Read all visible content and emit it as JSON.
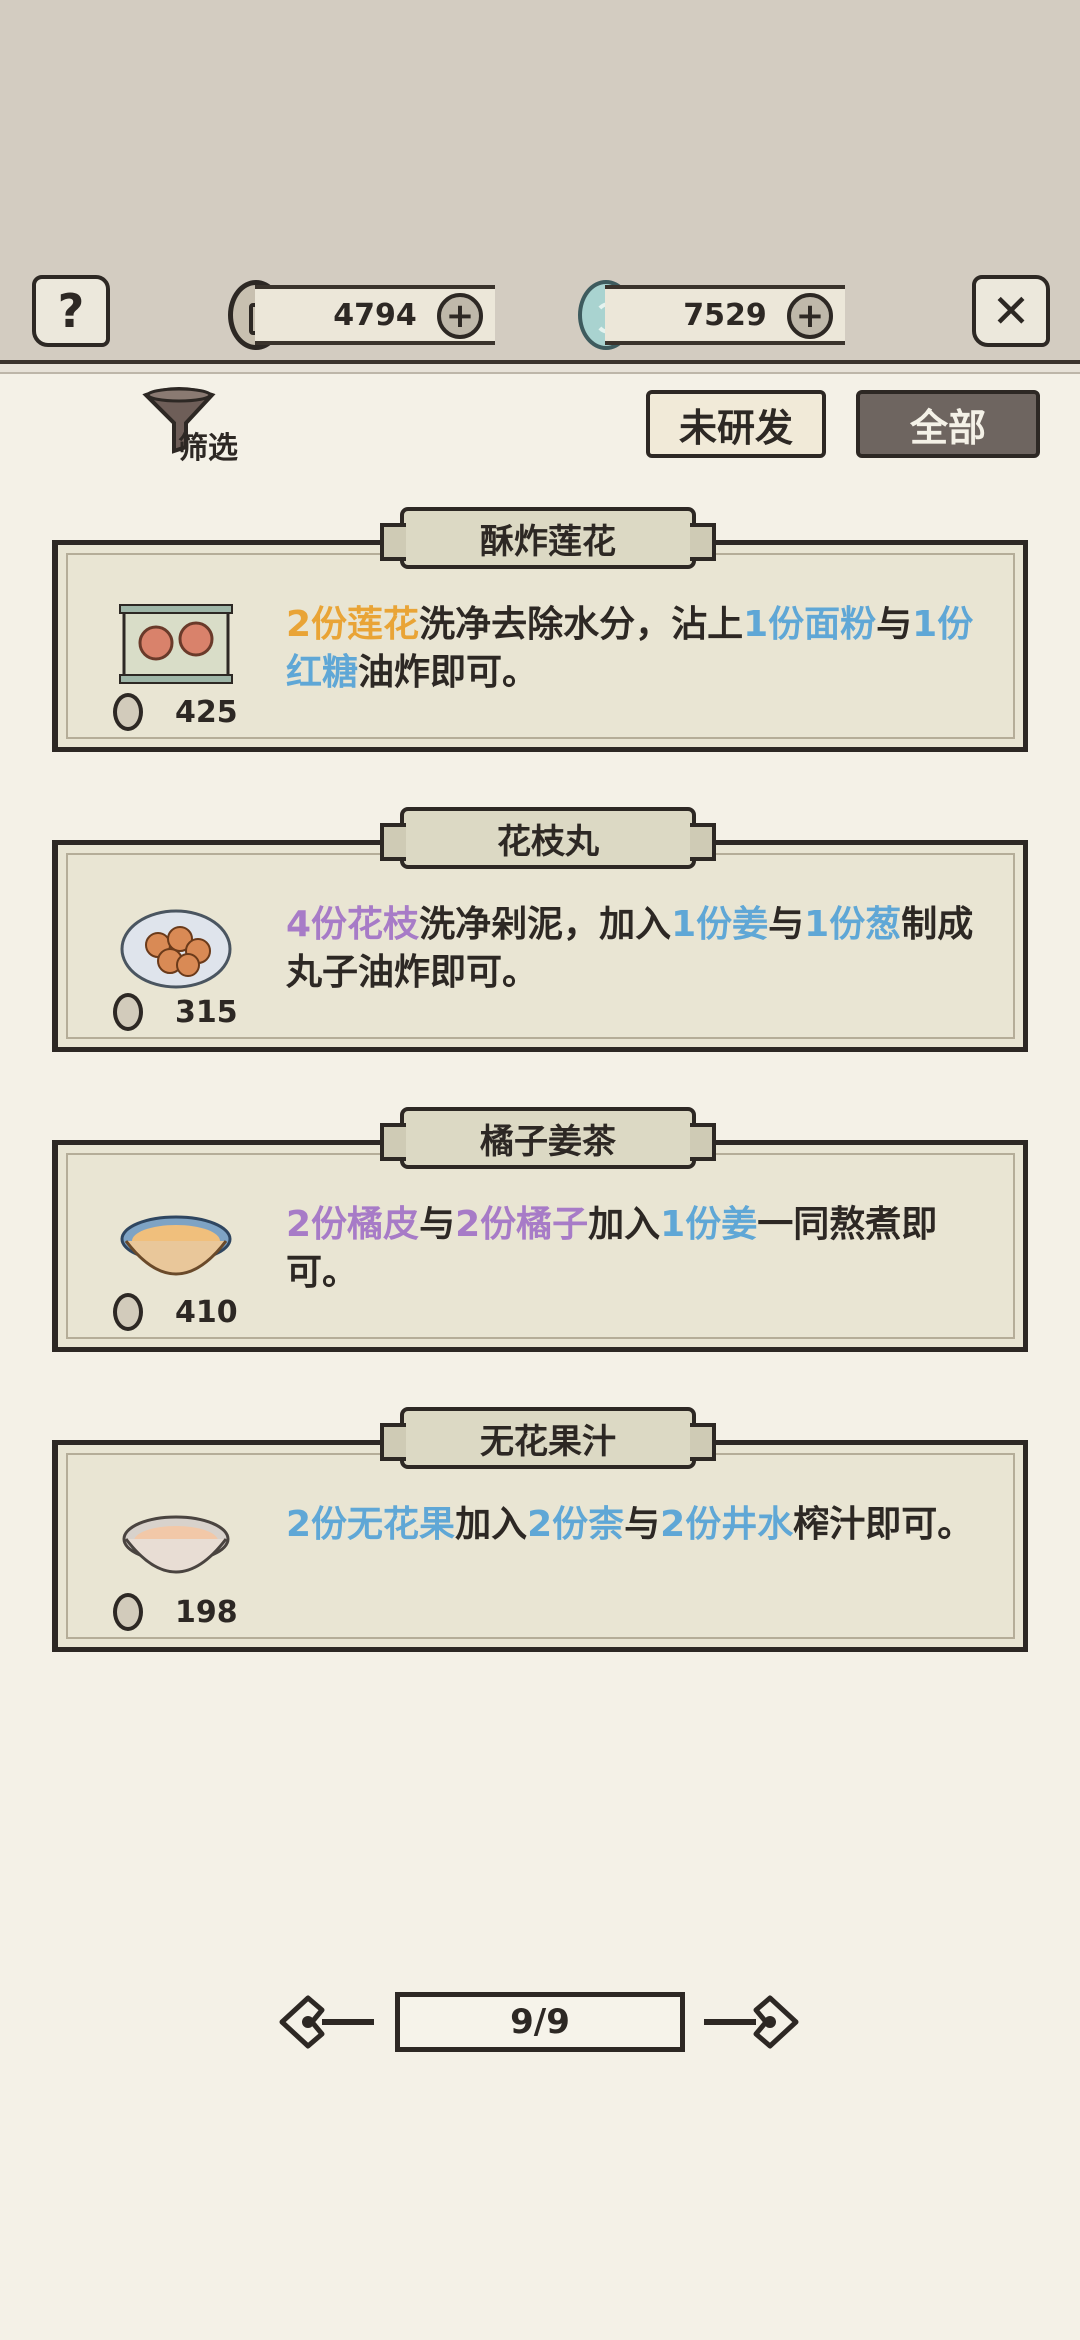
{
  "currency": {
    "coins": "4794",
    "jade": "7529"
  },
  "filter": {
    "label": "筛选"
  },
  "tabs": {
    "unresearched": "未研发",
    "all": "全部"
  },
  "recipes": [
    {
      "title": "酥炸莲花",
      "price": "425",
      "dish_icon": "lotus-scroll-icon",
      "segments": [
        {
          "t": "2份莲花",
          "c": "o"
        },
        {
          "t": "洗净去除水分，沾上",
          "c": ""
        },
        {
          "t": "1份面粉",
          "c": "b"
        },
        {
          "t": "与",
          "c": ""
        },
        {
          "t": "1份红糖",
          "c": "b"
        },
        {
          "t": "油炸即可。",
          "c": ""
        }
      ]
    },
    {
      "title": "花枝丸",
      "price": "315",
      "dish_icon": "meatballs-plate-icon",
      "segments": [
        {
          "t": "4份花枝",
          "c": "p"
        },
        {
          "t": "洗净剁泥，加入",
          "c": ""
        },
        {
          "t": "1份姜",
          "c": "b"
        },
        {
          "t": "与",
          "c": ""
        },
        {
          "t": "1份葱",
          "c": "b"
        },
        {
          "t": "制成丸子油炸即可。",
          "c": ""
        }
      ]
    },
    {
      "title": "橘子姜茶",
      "price": "410",
      "dish_icon": "tea-bowl-icon",
      "segments": [
        {
          "t": "2份橘皮",
          "c": "p"
        },
        {
          "t": "与",
          "c": ""
        },
        {
          "t": "2份橘子",
          "c": "p"
        },
        {
          "t": "加入",
          "c": ""
        },
        {
          "t": "1份姜",
          "c": "b"
        },
        {
          "t": "一同熬煮即可。",
          "c": ""
        }
      ]
    },
    {
      "title": "无花果汁",
      "price": "198",
      "dish_icon": "juice-bowl-icon",
      "segments": [
        {
          "t": "2份无花果",
          "c": "b"
        },
        {
          "t": "加入",
          "c": ""
        },
        {
          "t": "2份柰",
          "c": "b"
        },
        {
          "t": "与",
          "c": ""
        },
        {
          "t": "2份井水",
          "c": "b"
        },
        {
          "t": "榨汁即可。",
          "c": ""
        }
      ]
    }
  ],
  "pager": {
    "label": "9/9"
  },
  "colors": {
    "ingredient_orange": "#e9a436",
    "ingredient_blue": "#5fa7d6",
    "ingredient_purple": "#a77bc7",
    "ink": "#2d2824"
  }
}
